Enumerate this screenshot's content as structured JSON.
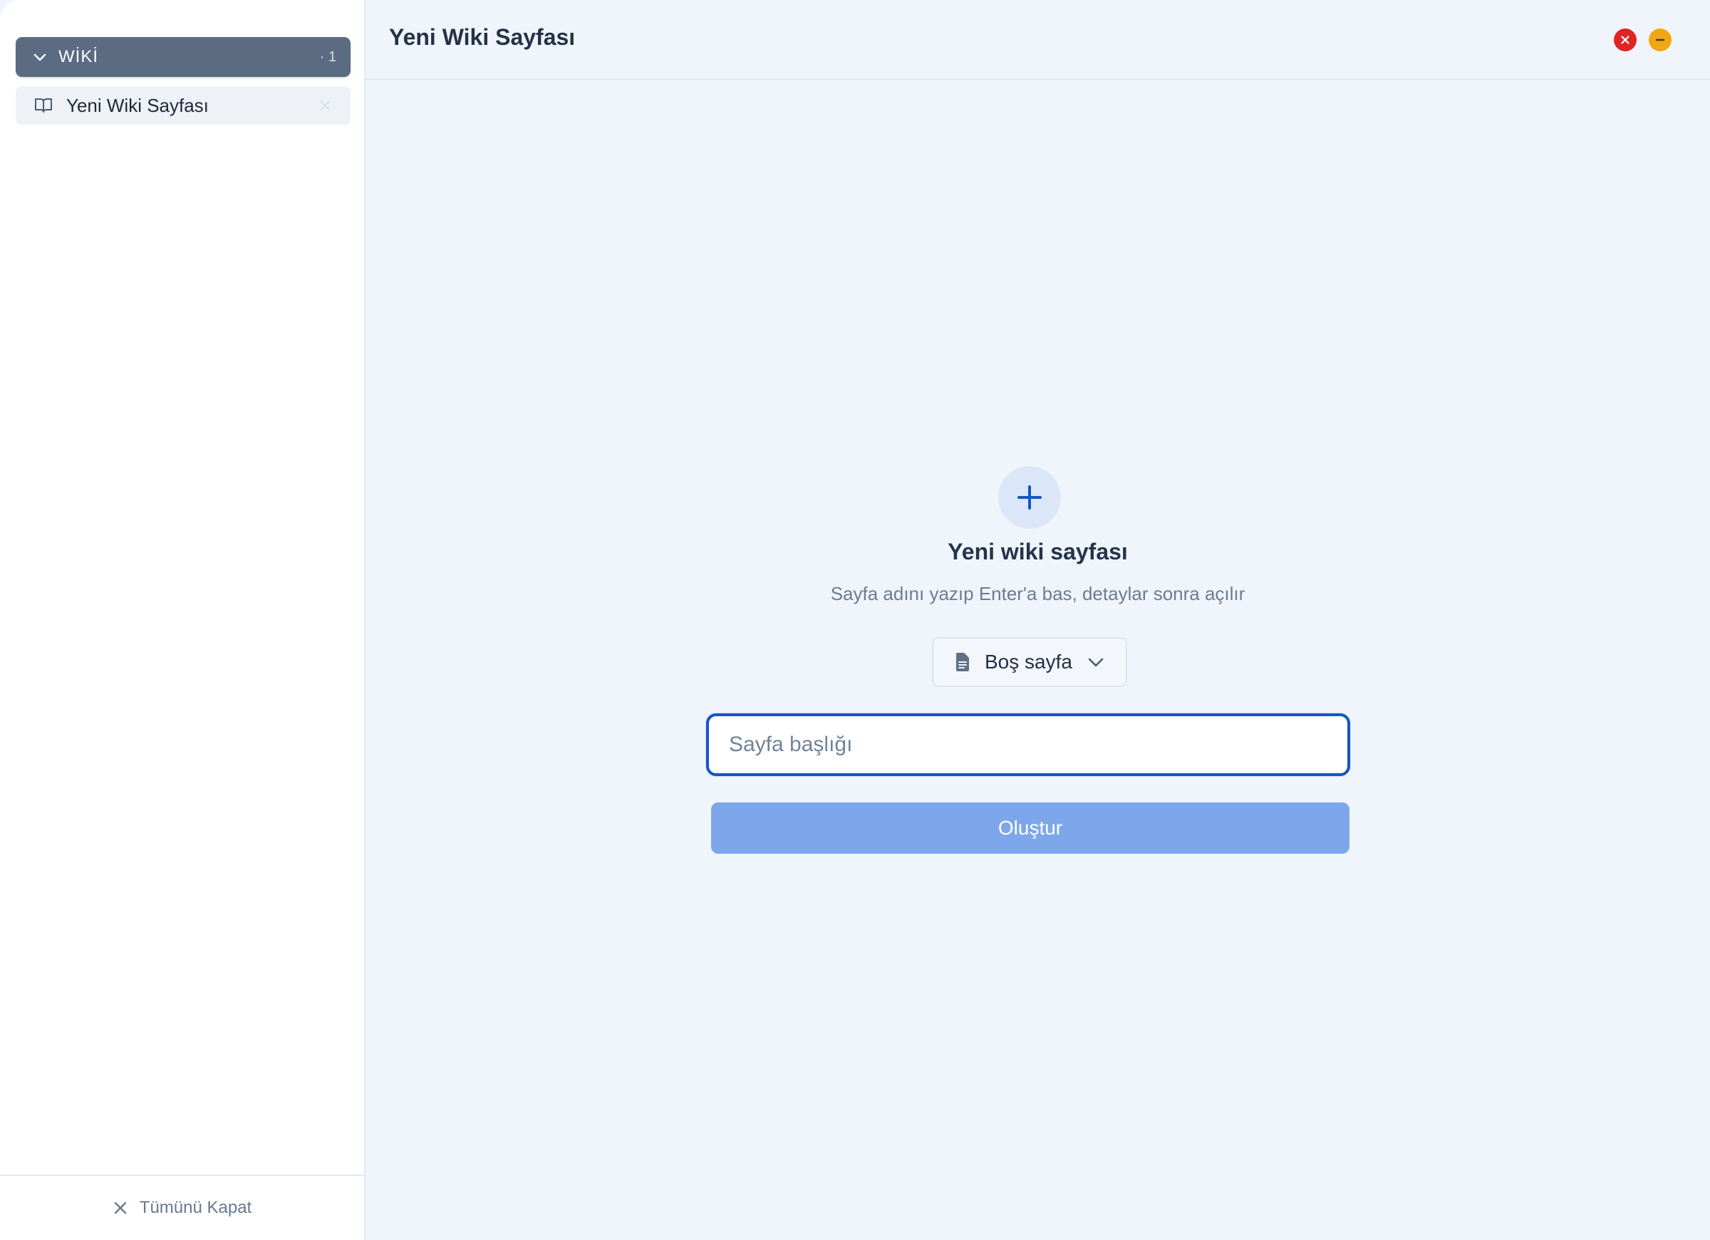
{
  "sidebar": {
    "group": {
      "label": "WİKİ",
      "count": "· 1",
      "expanded": true
    },
    "tabs": [
      {
        "label": "Yeni Wiki Sayfası",
        "icon": "book-open-icon",
        "active": true
      }
    ],
    "footer": {
      "close_all_label": "Tümünü Kapat"
    }
  },
  "header": {
    "title": "Yeni Wiki Sayfası",
    "window_controls": {
      "close_color": "#e02424",
      "minimize_color": "#f1a615"
    }
  },
  "main": {
    "icon": "plus-icon",
    "heading": "Yeni wiki sayfası",
    "subheading": "Sayfa adını yazıp Enter'a bas, detaylar sonra açılır",
    "template_select": {
      "selected": "Boş sayfa",
      "icon": "document-icon"
    },
    "title_input": {
      "placeholder": "Sayfa başlığı",
      "value": ""
    },
    "create_button": {
      "label": "Oluştur",
      "disabled": true
    }
  },
  "colors": {
    "accent": "#1556c4",
    "button_disabled": "#7ea6ea",
    "sidebar_header": "#5a6b82",
    "background": "#f0f5fc"
  }
}
